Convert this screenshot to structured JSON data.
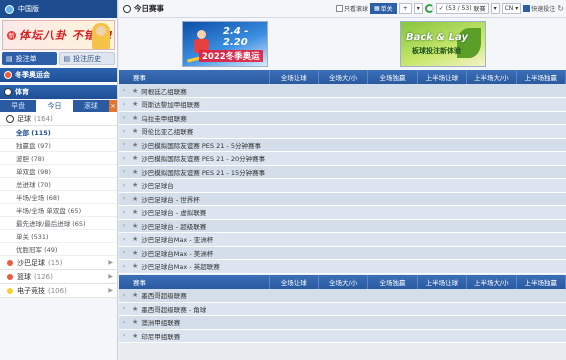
{
  "sidebar": {
    "region": "中国版",
    "promo_title": "体坛八卦 不错过!",
    "promo_badge": "新",
    "bet_slip": "投注单",
    "bet_history": "投注历史",
    "winter_section": "冬季奥运会",
    "sports_section": "体育",
    "tabs": [
      "早盘",
      "今日",
      "滚球"
    ],
    "tab_x": "✕",
    "football_label": "足球",
    "football_count": "(164)",
    "items": [
      "全部 (115)",
      "独赢盘 (97)",
      "波胆 (78)",
      "单双盘 (98)",
      "总进球 (70)",
      "半场/全场 (68)",
      "半场/全场 单双盘 (65)",
      "最先进球/最后进球 (65)",
      "单关 (531)",
      "优胜冠军 (49)"
    ],
    "others": [
      {
        "label": "沙巴足球",
        "count": "(15)"
      },
      {
        "label": "篮球",
        "count": "(126)"
      },
      {
        "label": "电子竞技",
        "count": "(106)"
      }
    ]
  },
  "topbar": {
    "title": "今日赛事",
    "hide_label": "只看滚球",
    "single_label": "单关",
    "plus": "+",
    "counter": "(53 / 53)",
    "market_label": "联赛",
    "lang": "CN",
    "quick_bet": "快速投注"
  },
  "banners": {
    "left_line1": "2.4 - 2.20",
    "left_line2": "2022冬季奥运",
    "right_line1": "Back & Lay",
    "right_line2": "板球投注新体验"
  },
  "table1": {
    "headers": [
      "赛事",
      "全场让球",
      "全场大/小",
      "全场独赢",
      "上半场让球",
      "上半场大/小",
      "上半场独赢"
    ],
    "rows": [
      "阿根廷乙组联赛",
      "哥斯达黎加甲组联赛",
      "乌拉圭甲组联赛",
      "哥伦比亚乙组联赛",
      "沙巴模拟国际友谊赛 PES 21 - 5分钟赛事",
      "沙巴模拟国际友谊赛 PES 21 - 20分钟赛事",
      "沙巴模拟国际友谊赛 PES 21 - 15分钟赛事",
      "沙巴足球台",
      "沙巴足球台 - 世界杯",
      "沙巴足球台 - 虚拟联赛",
      "沙巴足球台 - 超级联赛",
      "沙巴足球台Max - 亚洲杯",
      "沙巴足球台Max - 美洲杯",
      "沙巴足球台Max - 英超联赛"
    ]
  },
  "table2": {
    "headers": [
      "赛事",
      "全场让球",
      "全场大/小",
      "全场独赢",
      "上半场让球",
      "上半场大/小",
      "上半场独赢"
    ],
    "rows": [
      "墨西哥超级联赛",
      "墨西哥超级联赛 - 角球",
      "澳洲甲组联赛",
      "印尼甲组联赛"
    ]
  }
}
